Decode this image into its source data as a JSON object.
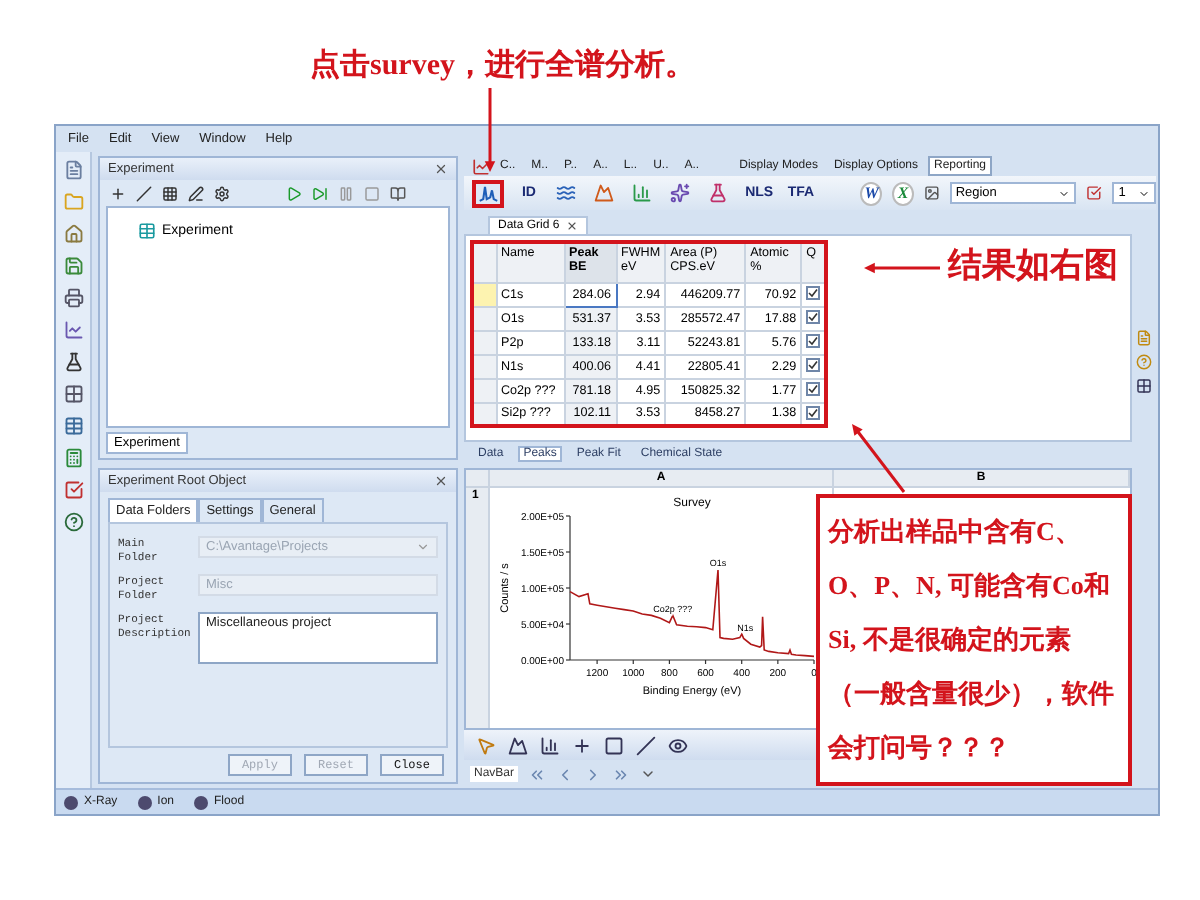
{
  "annotations": {
    "top_note": "点击survey，进行全谱分析。",
    "result_note": "结果如右图",
    "callout": "分析出样品中含有C、O、P、N, 可能含有Co和Si, 不是很确定的元素（一般含量很少），软件会打问号？？？"
  },
  "menu": [
    "File",
    "Edit",
    "View",
    "Window",
    "Help"
  ],
  "experiment_panel": {
    "title": "Experiment",
    "tree": [
      {
        "label": "Experiment",
        "selected": false
      }
    ],
    "tab": "Experiment"
  },
  "root_panel": {
    "title": "Experiment Root Object",
    "tabs": [
      {
        "label": "Data Folders",
        "selected": true
      },
      {
        "label": "Settings",
        "selected": false
      },
      {
        "label": "General",
        "selected": false
      }
    ],
    "fields": [
      {
        "kind": "dropdown",
        "label": "Main Folder",
        "value": "C:\\Avantage\\Projects",
        "disabled": true
      },
      {
        "kind": "text",
        "label": "Project Folder",
        "value": "Misc",
        "disabled": true
      },
      {
        "kind": "textarea",
        "label": "Project Description",
        "value": "Miscellaneous project",
        "disabled": false
      }
    ],
    "buttons": [
      {
        "label": "Apply",
        "disabled": true
      },
      {
        "label": "Reset",
        "disabled": true
      },
      {
        "label": "Close",
        "disabled": false
      }
    ]
  },
  "ribbon": {
    "tabs": [
      {
        "label": "C..",
        "selected": false
      },
      {
        "label": "M..",
        "selected": false
      },
      {
        "label": "P..",
        "selected": false
      },
      {
        "label": "A..",
        "selected": false
      },
      {
        "label": "L..",
        "selected": false
      },
      {
        "label": "U..",
        "selected": false
      },
      {
        "label": "A..",
        "selected": false
      },
      {
        "label": "Display Modes",
        "selected": false
      },
      {
        "label": "Display Options",
        "selected": false
      },
      {
        "label": "Reporting",
        "selected": true
      }
    ],
    "tools": [
      {
        "kind": "survey",
        "highlighted": true
      },
      {
        "kind": "text",
        "label": "ID",
        "highlighted": false
      },
      {
        "kind": "wave",
        "highlighted": false
      },
      {
        "kind": "peak",
        "highlighted": false
      },
      {
        "kind": "fit",
        "highlighted": false
      },
      {
        "kind": "star",
        "highlighted": false
      },
      {
        "kind": "flask",
        "highlighted": false
      },
      {
        "kind": "text",
        "label": "NLS",
        "highlighted": false
      },
      {
        "kind": "text",
        "label": "TFA",
        "highlighted": false
      }
    ],
    "report_tools": {
      "word": "W",
      "excel": "X",
      "region": "Region",
      "page": "1"
    }
  },
  "data_grid": {
    "tab": "Data Grid 6",
    "columns": [
      "Name",
      "Peak\nBE",
      "FWHM\neV",
      "Area (P)\nCPS.eV",
      "Atomic\n%",
      "Q"
    ],
    "rows": [
      {
        "name": "C1s",
        "peak_be": "284.06",
        "fwhm": "2.94",
        "area": "446209.77",
        "atomic": "70.92",
        "checked": true,
        "selected": true
      },
      {
        "name": "O1s",
        "peak_be": "531.37",
        "fwhm": "3.53",
        "area": "285572.47",
        "atomic": "17.88",
        "checked": true,
        "selected": false
      },
      {
        "name": "P2p",
        "peak_be": "133.18",
        "fwhm": "3.11",
        "area": "52243.81",
        "atomic": "5.76",
        "checked": true,
        "selected": false
      },
      {
        "name": "N1s",
        "peak_be": "400.06",
        "fwhm": "4.41",
        "area": "22805.41",
        "atomic": "2.29",
        "checked": true,
        "selected": false
      },
      {
        "name": "Co2p ???",
        "peak_be": "781.18",
        "fwhm": "4.95",
        "area": "150825.32",
        "atomic": "1.77",
        "checked": true,
        "selected": false
      },
      {
        "name": "Si2p ???",
        "peak_be": "102.11",
        "fwhm": "3.53",
        "area": "8458.27",
        "atomic": "1.38",
        "checked": true,
        "selected": false
      }
    ],
    "view_tabs": [
      {
        "label": "Data",
        "selected": false
      },
      {
        "label": "Peaks",
        "selected": true
      },
      {
        "label": "Peak Fit",
        "selected": false
      },
      {
        "label": "Chemical State",
        "selected": false
      }
    ]
  },
  "spectrum": {
    "columns": [
      "A",
      "B"
    ],
    "row_label": "1",
    "chart_data": {
      "type": "line",
      "title": "Survey",
      "xlabel": "Binding Energy (eV)",
      "ylabel": "Counts / s",
      "xlim": [
        1350,
        0
      ],
      "ylim": [
        0,
        200000
      ],
      "xticks": [
        1200,
        1000,
        800,
        600,
        400,
        200,
        0
      ],
      "yticks": [
        {
          "value": 0,
          "label": "0.00E+00"
        },
        {
          "value": 50000,
          "label": "5.00E+04"
        },
        {
          "value": 100000,
          "label": "1.00E+05"
        },
        {
          "value": 150000,
          "label": "1.50E+05"
        },
        {
          "value": 200000,
          "label": "2.00E+05"
        }
      ],
      "x": [
        1350,
        1300,
        1250,
        1240,
        1200,
        1150,
        1100,
        1050,
        1000,
        950,
        900,
        850,
        800,
        781,
        760,
        700,
        650,
        600,
        560,
        531,
        520,
        500,
        450,
        410,
        400,
        390,
        350,
        300,
        290,
        284,
        275,
        250,
        200,
        140,
        133,
        125,
        100,
        50,
        0
      ],
      "series": [
        {
          "color": "#b01818",
          "values": [
            95000,
            88000,
            92000,
            78000,
            76000,
            74000,
            72000,
            70000,
            68000,
            64000,
            62000,
            58000,
            52000,
            62000,
            49000,
            47000,
            46000,
            45000,
            42000,
            125000,
            31000,
            30000,
            29000,
            31000,
            36000,
            30000,
            22000,
            18000,
            20000,
            60000,
            14000,
            12000,
            10000,
            9000,
            14000,
            8000,
            7000,
            6000,
            5000
          ]
        }
      ],
      "annotations": [
        {
          "x": 781,
          "y": 66000,
          "text": "Co2p ???"
        },
        {
          "x": 531,
          "y": 130000,
          "text": "O1s"
        },
        {
          "x": 380,
          "y": 40000,
          "text": "N1s"
        }
      ]
    }
  },
  "navbar": "NavBar",
  "status": [
    "X-Ray",
    "Ion",
    "Flood"
  ]
}
